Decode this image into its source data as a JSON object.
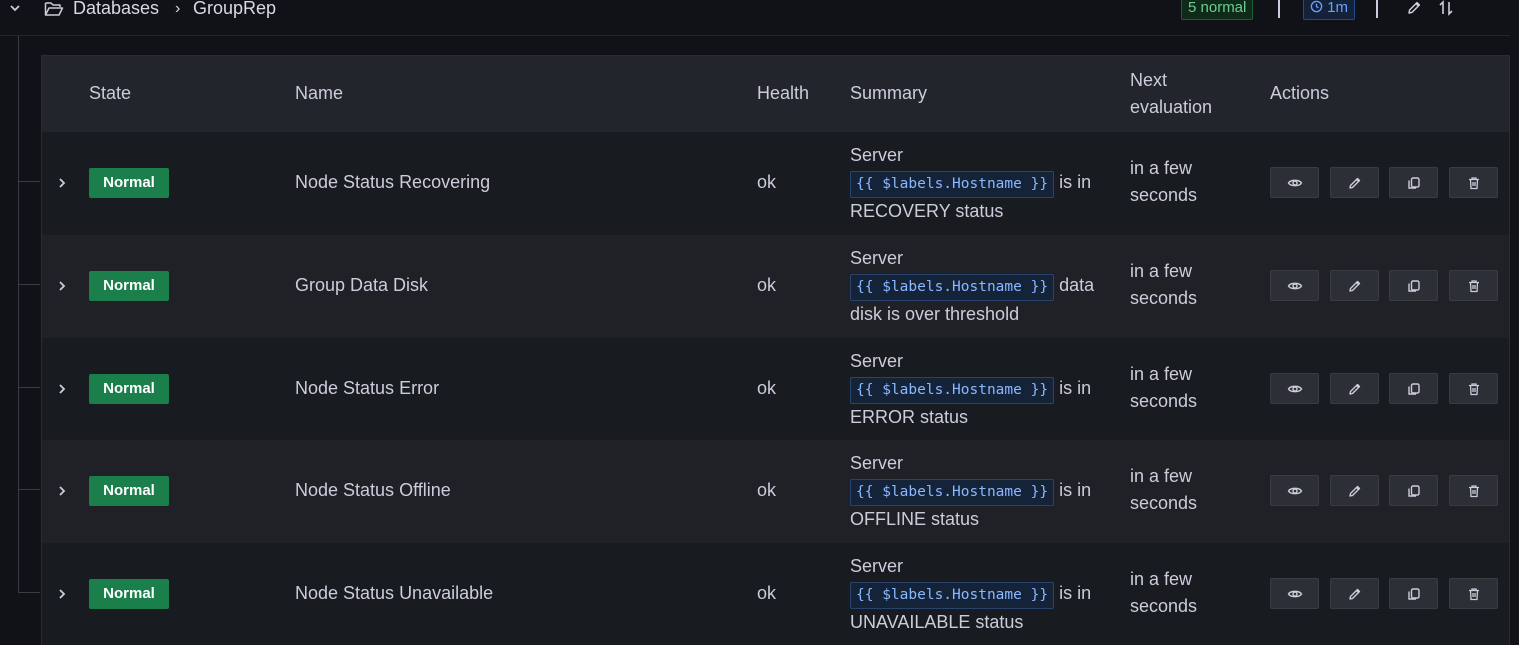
{
  "breadcrumb": {
    "folder": "Databases",
    "group": "GroupRep"
  },
  "status": {
    "normal_badge": "5 normal",
    "interval": "1m"
  },
  "columns": {
    "state": "State",
    "name": "Name",
    "health": "Health",
    "summary": "Summary",
    "next_eval_line1": "Next",
    "next_eval_line2": "evaluation",
    "actions": "Actions"
  },
  "rules": [
    {
      "state": "Normal",
      "name": "Node Status Recovering",
      "health": "ok",
      "summary_prefix": "Server",
      "summary_template": "{{ $labels.Hostname }}",
      "summary_suffix": "is in",
      "summary_tail": "RECOVERY status",
      "next_eval_line1": "in a few",
      "next_eval_line2": "seconds"
    },
    {
      "state": "Normal",
      "name": "Group Data Disk",
      "health": "ok",
      "summary_prefix": "Server",
      "summary_template": "{{ $labels.Hostname }}",
      "summary_suffix": "data",
      "summary_tail": "disk is over threshold",
      "next_eval_line1": "in a few",
      "next_eval_line2": "seconds"
    },
    {
      "state": "Normal",
      "name": "Node Status Error",
      "health": "ok",
      "summary_prefix": "Server",
      "summary_template": "{{ $labels.Hostname }}",
      "summary_suffix": "is in",
      "summary_tail": "ERROR status",
      "next_eval_line1": "in a few",
      "next_eval_line2": "seconds"
    },
    {
      "state": "Normal",
      "name": "Node Status Offline",
      "health": "ok",
      "summary_prefix": "Server",
      "summary_template": "{{ $labels.Hostname }}",
      "summary_suffix": "is in",
      "summary_tail": "OFFLINE status",
      "next_eval_line1": "in a few",
      "next_eval_line2": "seconds"
    },
    {
      "state": "Normal",
      "name": "Node Status Unavailable",
      "health": "ok",
      "summary_prefix": "Server",
      "summary_template": "{{ $labels.Hostname }}",
      "summary_suffix": "is in",
      "summary_tail": "UNAVAILABLE status",
      "next_eval_line1": "in a few",
      "next_eval_line2": "seconds"
    }
  ],
  "colors": {
    "normal_state": "#1a7f4b",
    "background": "#111217",
    "row_odd": "#181b1f",
    "row_even": "#1f2126",
    "header": "#22252b"
  },
  "icons": {
    "collapse": "chevron-down-icon",
    "folder": "folder-icon",
    "clock": "clock-icon",
    "edit": "pencil-icon",
    "sort": "sort-icon",
    "expand": "chevron-right-icon",
    "view": "eye-icon",
    "duplicate": "copy-icon",
    "delete": "trash-icon"
  }
}
